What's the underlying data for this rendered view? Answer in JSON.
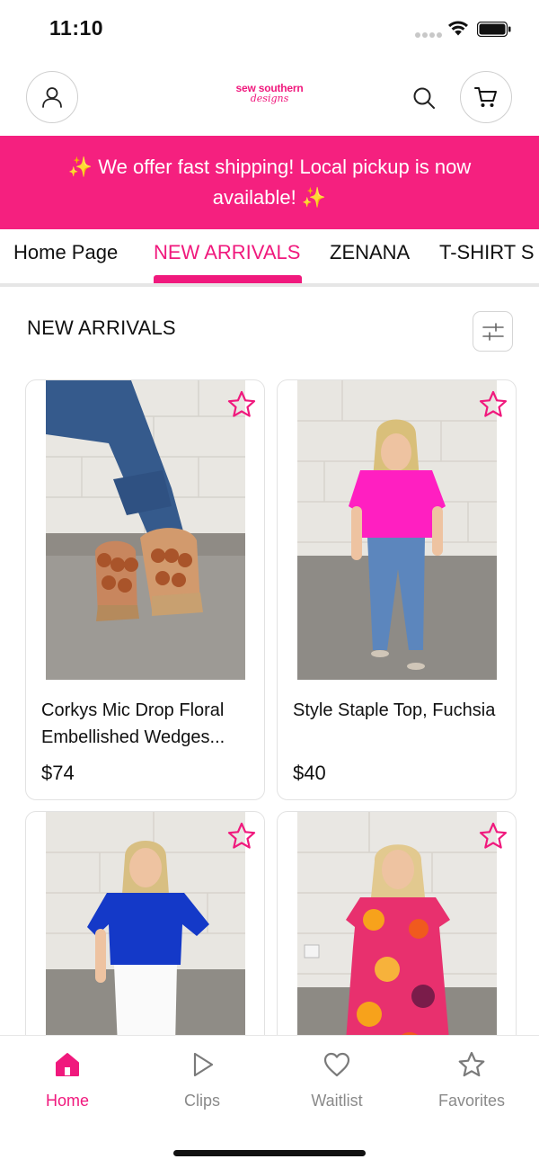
{
  "status_bar": {
    "time": "11:10",
    "icons": [
      "signal-dots-icon",
      "wifi-icon",
      "battery-icon"
    ]
  },
  "header": {
    "logo_line1": "sew southern",
    "logo_line2": "designs",
    "icons": [
      "account-icon",
      "search-icon",
      "cart-icon"
    ]
  },
  "banner": {
    "text": "✨ We offer fast shipping! Local pickup is now available! ✨",
    "background": "#f5207f"
  },
  "tabs": [
    {
      "label": "Home Page",
      "active": false
    },
    {
      "label": "NEW ARRIVALS",
      "active": true
    },
    {
      "label": "ZENANA",
      "active": false
    },
    {
      "label": "T-SHIRT S",
      "active": false
    }
  ],
  "section": {
    "title": "NEW ARRIVALS",
    "filter_icon": "filter-sliders-icon"
  },
  "products": [
    {
      "name": "Corkys Mic Drop Floral Embellished Wedges...",
      "price": "$74"
    },
    {
      "name": "Style Staple Top, Fuchsia",
      "price": "$40"
    },
    {
      "name": "",
      "price": ""
    },
    {
      "name": "",
      "price": ""
    }
  ],
  "bottom_nav": [
    {
      "label": "Home",
      "icon": "home-icon",
      "active": true
    },
    {
      "label": "Clips",
      "icon": "play-icon",
      "active": false
    },
    {
      "label": "Waitlist",
      "icon": "heart-icon",
      "active": false
    },
    {
      "label": "Favorites",
      "icon": "star-icon",
      "active": false
    }
  ],
  "colors": {
    "accent": "#f0197d",
    "inactive": "#8a8a8a",
    "border": "#e2e2e2"
  }
}
